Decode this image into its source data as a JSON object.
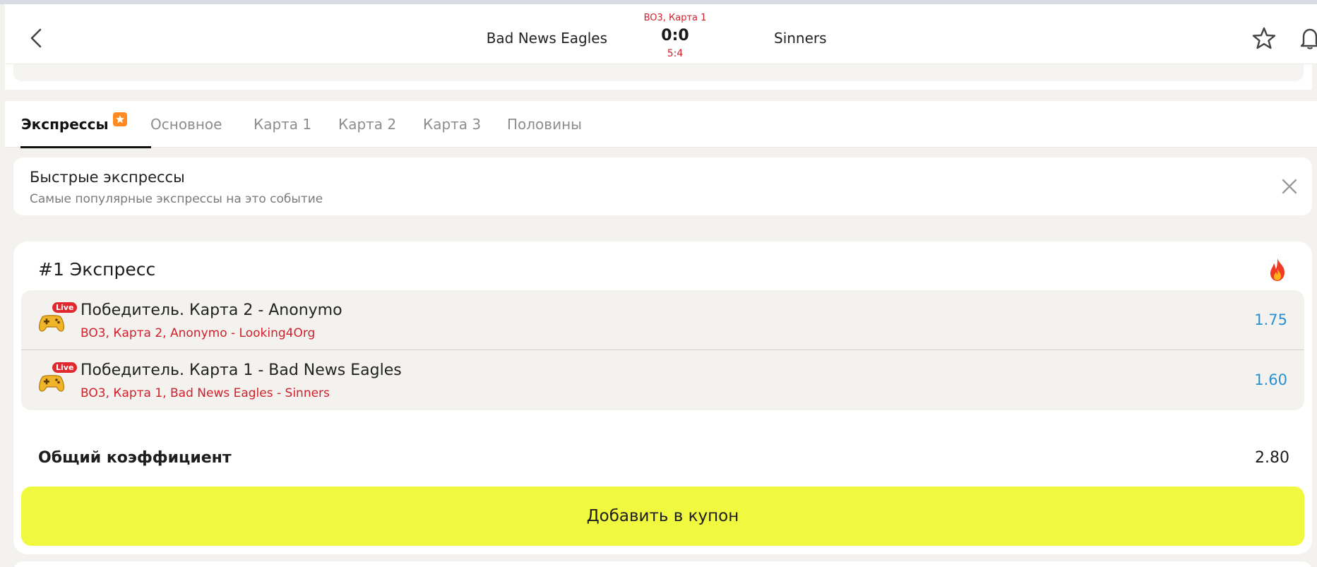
{
  "header": {
    "team_home": "Bad News Eagles",
    "team_away": "Sinners",
    "stage": "BO3, Карта 1",
    "score": "0:0",
    "sub_score": "5:4"
  },
  "tabs": [
    {
      "label": "Экспрессы",
      "active": true
    },
    {
      "label": "Основное"
    },
    {
      "label": "Карта 1"
    },
    {
      "label": "Карта 2"
    },
    {
      "label": "Карта 3"
    },
    {
      "label": "Половины"
    }
  ],
  "quick_express": {
    "title": "Быстрые экспрессы",
    "subtitle": "Самые популярные экспрессы на это событие"
  },
  "express": {
    "title": "#1 Экспресс",
    "legs": [
      {
        "live_label": "Live",
        "title": "Победитель. Карта 2 - Anonymo",
        "subtitle": "BO3, Карта 2, Anonymo - Looking4Org",
        "odd": "1.75"
      },
      {
        "live_label": "Live",
        "title": "Победитель. Карта 1 - Bad News Eagles",
        "subtitle": "BO3, Карта 1, Bad News Eagles - Sinners",
        "odd": "1.60"
      }
    ],
    "total_label": "Общий коэффициент",
    "total_value": "2.80",
    "add_button": "Добавить в купон"
  },
  "colors": {
    "accent_red": "#d0202c",
    "odd_blue": "#2a8fd0",
    "button_yellow": "#f0f93f",
    "badge_orange": "#ff8a1f",
    "background": "#f4f2ee"
  },
  "icons": {
    "back": "chevron-left-icon",
    "favorite": "star-icon",
    "notifications": "bell-icon",
    "close": "close-icon",
    "hot": "fire-icon",
    "sport": "gamepad-icon"
  }
}
